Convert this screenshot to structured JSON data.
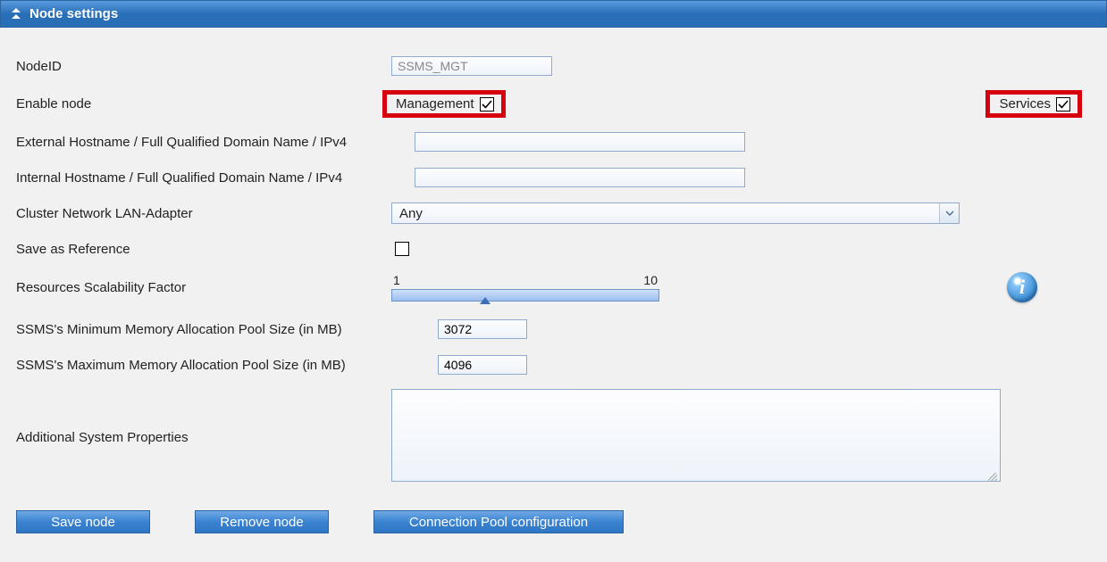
{
  "panel": {
    "title": "Node settings"
  },
  "fields": {
    "nodeId": {
      "label": "NodeID",
      "value": "SSMS_MGT"
    },
    "enableNode": {
      "label": "Enable node",
      "management": {
        "label": "Management",
        "checked": true
      },
      "services": {
        "label": "Services",
        "checked": true
      }
    },
    "externalHost": {
      "label": "External Hostname / Full Qualified Domain Name / IPv4",
      "value": ""
    },
    "internalHost": {
      "label": "Internal Hostname / Full Qualified Domain Name / IPv4",
      "value": ""
    },
    "clusterAdapter": {
      "label": "Cluster Network LAN-Adapter",
      "value": "Any"
    },
    "saveRef": {
      "label": "Save as Reference",
      "checked": false
    },
    "scalability": {
      "label": "Resources Scalability Factor",
      "min": "1",
      "max": "10"
    },
    "minMem": {
      "label": "SSMS's Minimum Memory Allocation Pool Size (in MB)",
      "value": "3072"
    },
    "maxMem": {
      "label": "SSMS's Maximum Memory Allocation Pool Size (in MB)",
      "value": "4096"
    },
    "additional": {
      "label": "Additional System Properties",
      "value": ""
    }
  },
  "buttons": {
    "save": "Save node",
    "remove": "Remove node",
    "connPool": "Connection Pool configuration"
  },
  "info": {
    "glyph": "i"
  }
}
